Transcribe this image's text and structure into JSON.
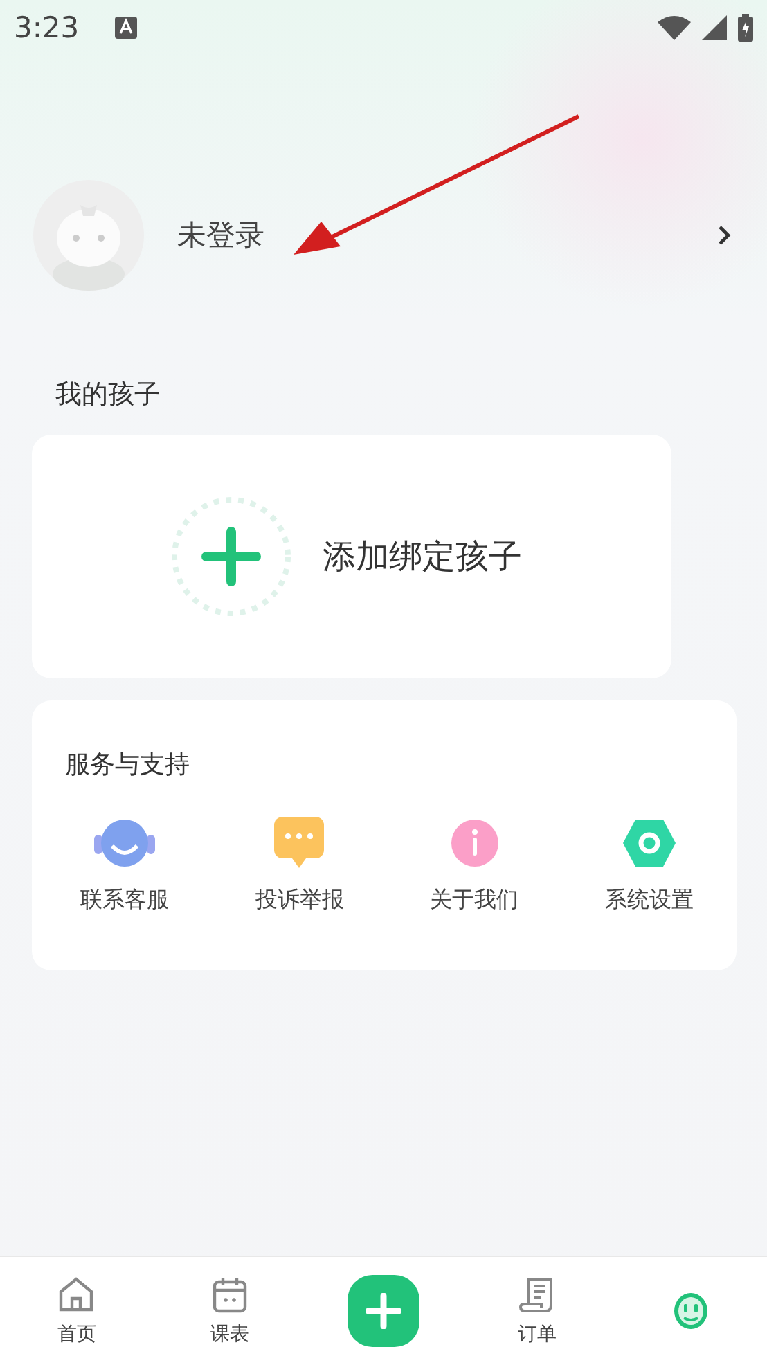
{
  "status_bar": {
    "time": "3:23"
  },
  "profile": {
    "name": "未登录"
  },
  "children_section": {
    "title": "我的孩子",
    "add_label": "添加绑定孩子"
  },
  "services": {
    "title": "服务与支持",
    "items": [
      {
        "kind": "headset",
        "label": "联系客服"
      },
      {
        "kind": "chat",
        "label": "投诉举报"
      },
      {
        "kind": "info",
        "label": "关于我们"
      },
      {
        "kind": "settings",
        "label": "系统设置"
      }
    ]
  },
  "bottom_nav": [
    {
      "kind": "home",
      "label": "首页",
      "selected": false
    },
    {
      "kind": "calendar",
      "label": "课表",
      "selected": false
    },
    {
      "kind": "add",
      "selected": false
    },
    {
      "kind": "orders",
      "label": "订单",
      "selected": false
    },
    {
      "kind": "me",
      "selected": true
    }
  ]
}
